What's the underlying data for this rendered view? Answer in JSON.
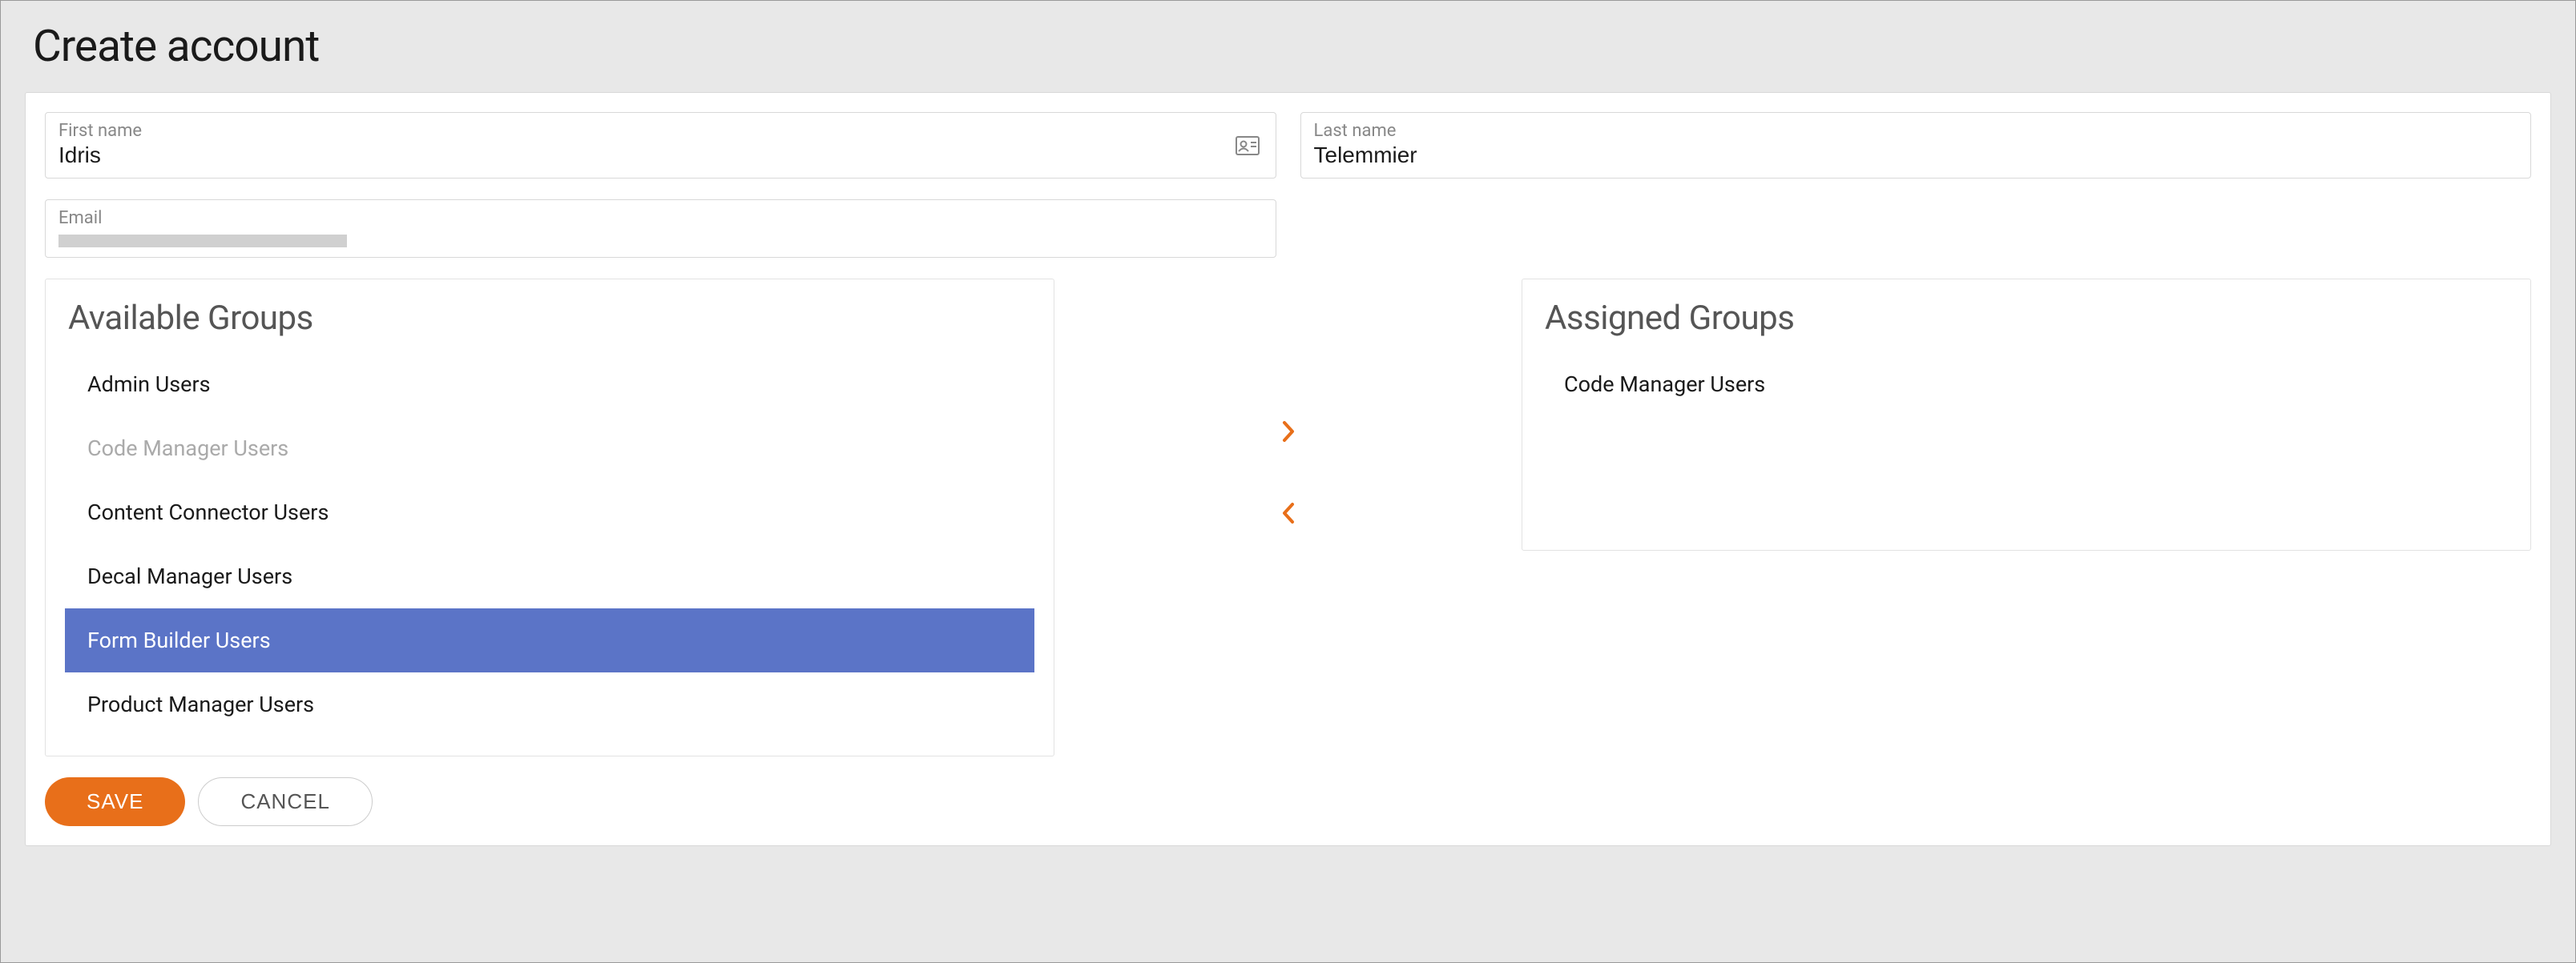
{
  "page_title": "Create account",
  "fields": {
    "first_name": {
      "label": "First name",
      "value": "Idris"
    },
    "last_name": {
      "label": "Last name",
      "value": "Telemmier"
    },
    "email": {
      "label": "Email",
      "value": ""
    }
  },
  "groups": {
    "available_title": "Available Groups",
    "assigned_title": "Assigned Groups",
    "available": [
      {
        "label": "Admin Users",
        "state": "normal"
      },
      {
        "label": "Code Manager Users",
        "state": "disabled"
      },
      {
        "label": "Content Connector Users",
        "state": "normal"
      },
      {
        "label": "Decal Manager Users",
        "state": "normal"
      },
      {
        "label": "Form Builder Users",
        "state": "selected"
      },
      {
        "label": "Product Manager Users",
        "state": "normal"
      }
    ],
    "assigned": [
      {
        "label": "Code Manager Users",
        "state": "normal"
      }
    ]
  },
  "buttons": {
    "save": "SAVE",
    "cancel": "CANCEL"
  },
  "colors": {
    "accent": "#e86f1a",
    "selected": "#5b74c7"
  }
}
